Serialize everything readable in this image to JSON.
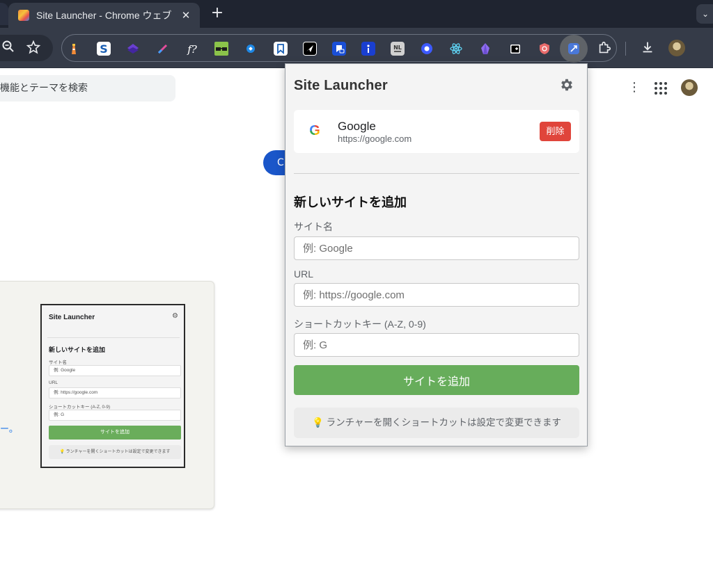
{
  "browser": {
    "tab": {
      "title": "Site Launcher - Chrome ウェブ",
      "close": "✕"
    },
    "new_tab": "+",
    "tab_menu": "⌄"
  },
  "toolbar": {
    "icons": [
      "zoom-icon",
      "star-icon",
      "download-icon",
      "extensions-icon",
      "profile-avatar"
    ]
  },
  "page": {
    "search_placeholder": "機能とテーマを検索",
    "blue_button_label": "C",
    "more_dots": "⋮",
    "preview_text_1": "ᵗ",
    "preview_text_2": "ー。"
  },
  "mini_preview": {
    "title": "Site Launcher",
    "section_title": "新しいサイトを追加",
    "label_name": "サイト名",
    "placeholder_name": "例: Google",
    "label_url": "URL",
    "placeholder_url": "例: https://google.com",
    "label_key": "ショートカットキー (A-Z, 0-9)",
    "placeholder_key": "例: G",
    "add_button": "サイトを追加",
    "tip": "ランチャーを開くショートカットは設定で変更できます"
  },
  "popup": {
    "title": "Site Launcher",
    "sites": [
      {
        "favicon": "G",
        "name": "Google",
        "url": "https://google.com",
        "delete_label": "削除"
      }
    ],
    "form": {
      "section_title": "新しいサイトを追加",
      "name_label": "サイト名",
      "name_placeholder": "例: Google",
      "url_label": "URL",
      "url_placeholder": "例: https://google.com",
      "key_label": "ショートカットキー (A-Z, 0-9)",
      "key_placeholder": "例: G",
      "add_button": "サイトを追加"
    },
    "tip": "ランチャーを開くショートカットは設定で変更できます",
    "tip_icon": "💡"
  },
  "colors": {
    "accent_green": "#67ad5b",
    "delete_red": "#e0453b",
    "chrome_dark": "#353b48"
  }
}
